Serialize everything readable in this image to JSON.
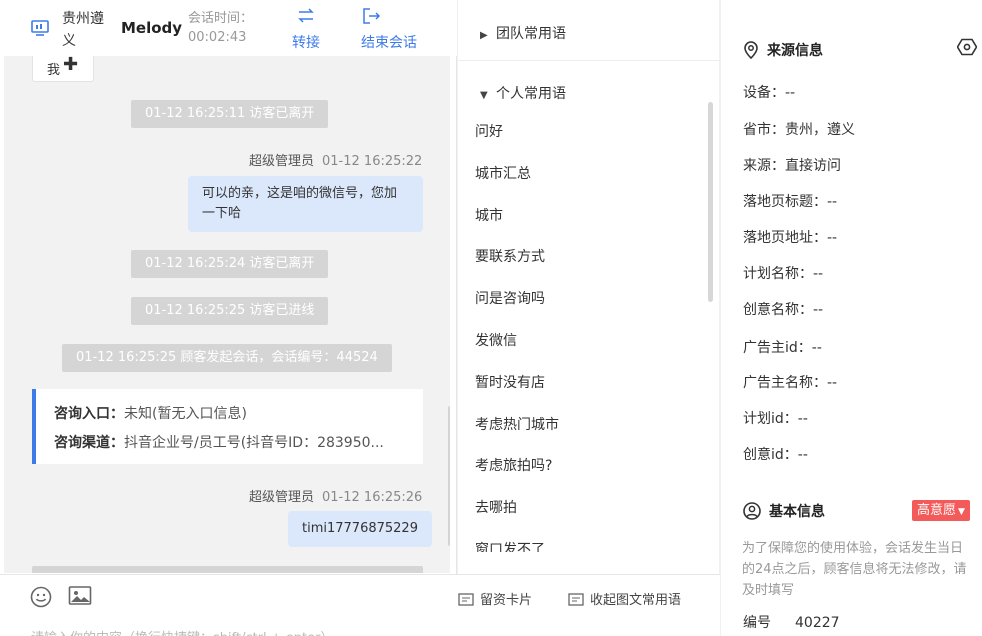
{
  "header": {
    "visitor_location": "贵州遵义",
    "agent_name": "Melody",
    "session_time_label": "会话时间：",
    "session_time": "00:02:43",
    "transfer_label": "转接",
    "end_session_label": "结束会话"
  },
  "chat": {
    "me_chip_label": "我",
    "system_messages": [
      "01-12 16:25:11 访客已离开",
      "01-12 16:25:24 访客已离开",
      "01-12 16:25:25 访客已进线",
      "01-12 16:25:25 顾客发起会话，会话编号：44524"
    ],
    "messages": [
      {
        "sender": "超级管理员",
        "time": "01-12 16:25:22",
        "text": "可以的亲，这是咱的微信号，您加一下哈"
      },
      {
        "sender": "超级管理员",
        "time": "01-12 16:25:26",
        "text": "timi17776875229"
      }
    ],
    "consult_card": {
      "entry_label": "咨询入口：",
      "entry_value": "未知(暂无入口信息)",
      "channel_label": "咨询渠道：",
      "channel_value": "抖音企业号/员工号(抖音号ID：283950..."
    }
  },
  "toolbar": {
    "card_label": "留资卡片",
    "collapse_label": "收起图文常用语",
    "input_placeholder": "请输入你的内容（换行快捷键：shift/ctrl + enter）"
  },
  "phrases": {
    "team_group": "团队常用语",
    "personal_group": "个人常用语",
    "items": [
      "问好",
      "城市汇总",
      "城市",
      "要联系方式",
      "问是咨询吗",
      "发微信",
      "暂时没有店",
      "考虑热门城市",
      "考虑旅拍吗?",
      "去哪拍",
      "窗口发不了"
    ]
  },
  "info": {
    "source_title": "来源信息",
    "source_rows": [
      {
        "label": "设备：",
        "value": "--"
      },
      {
        "label": "省市：",
        "value": "贵州，遵义"
      },
      {
        "label": "来源：",
        "value": "直接访问"
      },
      {
        "label": "落地页标题：",
        "value": "--"
      },
      {
        "label": "落地页地址：",
        "value": "--"
      },
      {
        "label": "计划名称：",
        "value": "--"
      },
      {
        "label": "创意名称：",
        "value": "--"
      },
      {
        "label": "广告主id：",
        "value": "--"
      },
      {
        "label": "广告主名称：",
        "value": "--"
      },
      {
        "label": "计划id：",
        "value": "--"
      },
      {
        "label": "创意id：",
        "value": "--"
      }
    ],
    "basic_title": "基本信息",
    "intent_badge": "高意愿",
    "note": "为了保障您的使用体验，会话发生当日的24点之后，顾客信息将无法修改，请及时填写",
    "id_label": "编号",
    "id_value": "40227"
  },
  "colors": {
    "accent": "#3e7be8",
    "badge": "#f35a5a",
    "bubble": "#dbe7fb",
    "system": "#d5d5d5"
  }
}
